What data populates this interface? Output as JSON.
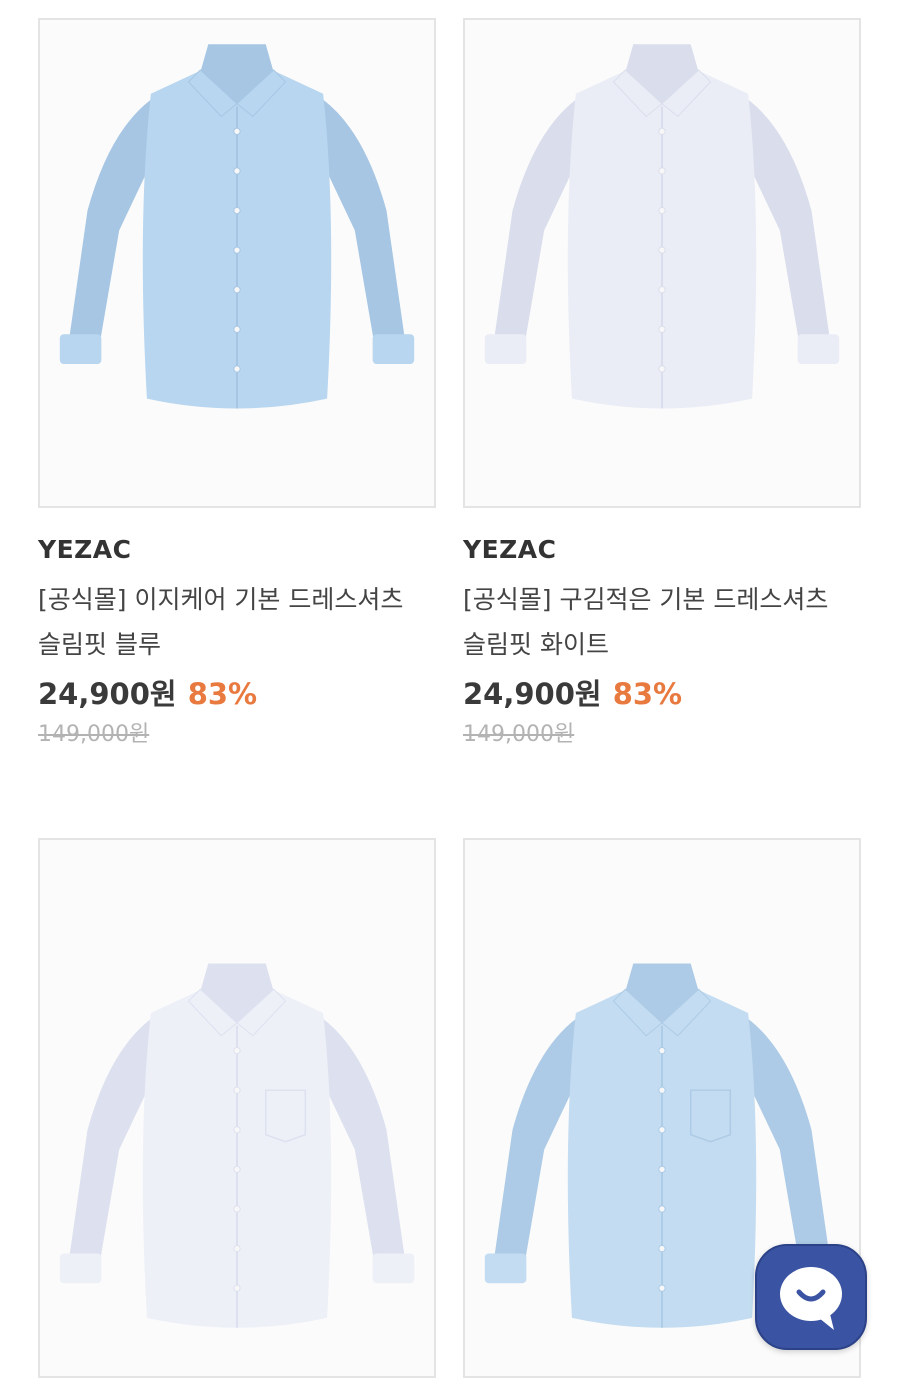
{
  "products": [
    {
      "brand": "YEZAC",
      "title": "[공식몰] 이지케어 기본 드레스셔츠 슬림핏 블루",
      "price": "24,900원",
      "discount": "83%",
      "original_price": "149,000원",
      "shirt_color": "#b8d6ef",
      "shirt_shade": "#a6c6e4"
    },
    {
      "brand": "YEZAC",
      "title": "[공식몰] 구김적은 기본 드레스셔츠 슬림핏 화이트",
      "price": "24,900원",
      "discount": "83%",
      "original_price": "149,000원",
      "shirt_color": "#ebedf6",
      "shirt_shade": "#dadeec"
    },
    {
      "shirt_color": "#eef0f8",
      "shirt_shade": "#dde1ef"
    },
    {
      "shirt_color": "#c3dcf1",
      "shirt_shade": "#adcbe6"
    }
  ],
  "chat_button": {
    "icon": "chat-smile-icon",
    "color": "#3a53a3"
  }
}
